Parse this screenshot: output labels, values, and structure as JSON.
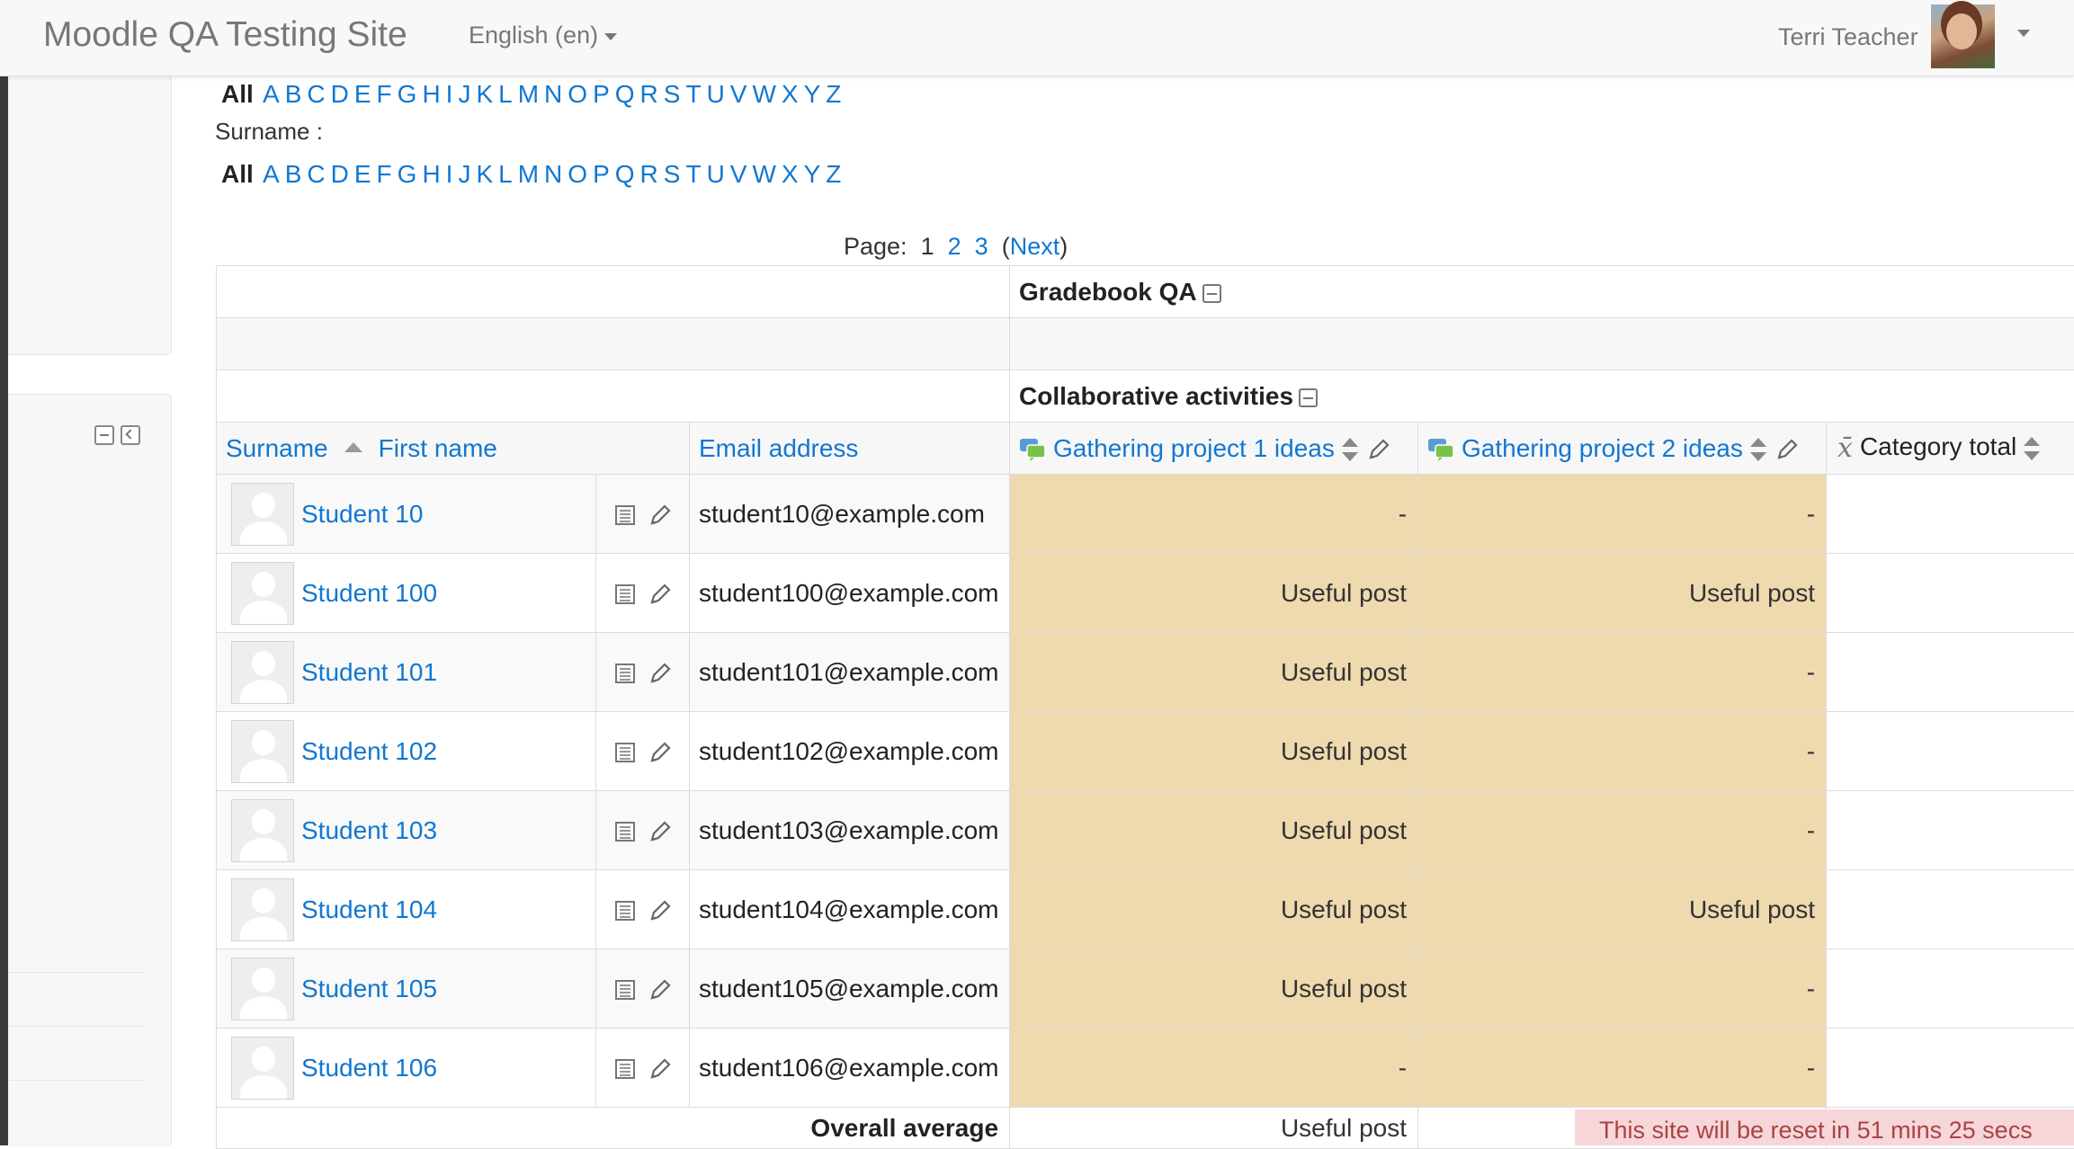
{
  "navbar": {
    "brand": "Moodle QA Testing Site",
    "language": "English (en)",
    "user_name": "Terri Teacher",
    "user_menu_icon": "chevron-down-icon"
  },
  "firstname_initials": {
    "all": "All",
    "letters": [
      "A",
      "B",
      "C",
      "D",
      "E",
      "F",
      "G",
      "H",
      "I",
      "J",
      "K",
      "L",
      "M",
      "N",
      "O",
      "P",
      "Q",
      "R",
      "S",
      "T",
      "U",
      "V",
      "W",
      "X",
      "Y",
      "Z"
    ]
  },
  "surname_filter": {
    "label": "Surname :",
    "all": "All",
    "letters": [
      "A",
      "B",
      "C",
      "D",
      "E",
      "F",
      "G",
      "H",
      "I",
      "J",
      "K",
      "L",
      "M",
      "N",
      "O",
      "P",
      "Q",
      "R",
      "S",
      "T",
      "U",
      "V",
      "W",
      "X",
      "Y",
      "Z"
    ]
  },
  "paging": {
    "label": "Page:",
    "current": "1",
    "page2": "2",
    "page3": "3",
    "open_paren": "(",
    "next": "Next",
    "close_paren": ")"
  },
  "categories": {
    "course": "Gradebook QA",
    "sub": "Collaborative activities"
  },
  "columns": {
    "surname": "Surname",
    "firstname": "First name",
    "email": "Email address",
    "item1": "Gathering project 1 ideas",
    "item2": "Gathering project 2 ideas",
    "category_total": "Category total"
  },
  "students": [
    {
      "name": "Student 10",
      "email": "student10@example.com",
      "g1": "-",
      "g2": "-"
    },
    {
      "name": "Student 100",
      "email": "student100@example.com",
      "g1": "Useful post",
      "g2": "Useful post"
    },
    {
      "name": "Student 101",
      "email": "student101@example.com",
      "g1": "Useful post",
      "g2": "-"
    },
    {
      "name": "Student 102",
      "email": "student102@example.com",
      "g1": "Useful post",
      "g2": "-"
    },
    {
      "name": "Student 103",
      "email": "student103@example.com",
      "g1": "Useful post",
      "g2": "-"
    },
    {
      "name": "Student 104",
      "email": "student104@example.com",
      "g1": "Useful post",
      "g2": "Useful post"
    },
    {
      "name": "Student 105",
      "email": "student105@example.com",
      "g1": "Useful post",
      "g2": "-"
    },
    {
      "name": "Student 106",
      "email": "student106@example.com",
      "g1": "-",
      "g2": "-"
    }
  ],
  "overall_average": {
    "label": "Overall average",
    "g1": "Useful post"
  },
  "notice": "This site will be reset in 51 mins 25 secs",
  "colors": {
    "link": "#1177d1",
    "grade_cell_bg": "#efd9ae",
    "notice_bg": "#f7d6da",
    "navbar_bg": "#f8f8f8"
  }
}
